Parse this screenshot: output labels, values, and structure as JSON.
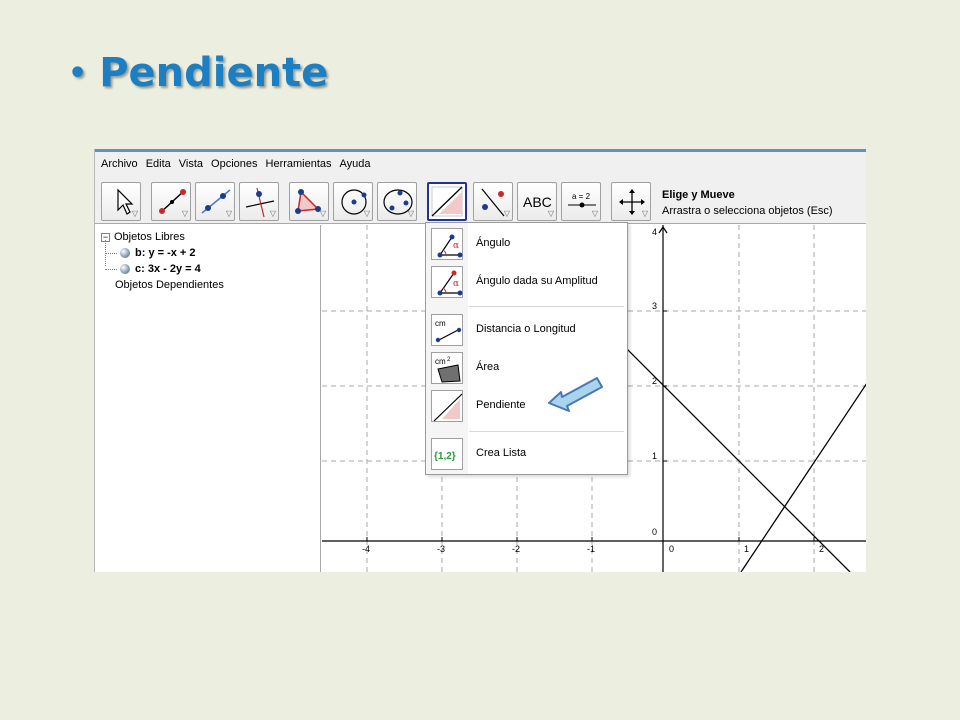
{
  "slide": {
    "title": "Pendiente"
  },
  "menu": [
    "Archivo",
    "Edita",
    "Vista",
    "Opciones",
    "Herramientas",
    "Ayuda"
  ],
  "toolbar": {
    "text_tool_label": "ABC",
    "slider_tool_label": "a = 2",
    "help_title": "Elige y Mueve",
    "help_text": "Arrastra o selecciona objetos (Esc)"
  },
  "algebra": {
    "free_objects": "Objetos Libres",
    "objects": [
      "b: y = -x + 2",
      "c: 3x - 2y = 4"
    ],
    "dependent_objects": "Objetos Dependientes"
  },
  "graphics": {
    "x_ticks": [
      "-4",
      "-3",
      "-2",
      "-1",
      "0",
      "1",
      "2"
    ],
    "y_ticks": [
      "4",
      "3",
      "2",
      "1",
      "0"
    ]
  },
  "dropdown": {
    "items": [
      "Ángulo",
      "Ángulo dada su Amplitud",
      "Distancia o Longitud",
      "Área",
      "Pendiente",
      "Crea Lista"
    ],
    "icon_text": {
      "alpha": "α",
      "cm": "cm",
      "cm2": "cm",
      "sup2": "2",
      "list": "{1,2}"
    }
  },
  "colors": {
    "title": "#1c7fc4",
    "arrow_fill": "#a8d4ee",
    "arrow_stroke": "#4a78b4",
    "active_border": "#21329a"
  }
}
